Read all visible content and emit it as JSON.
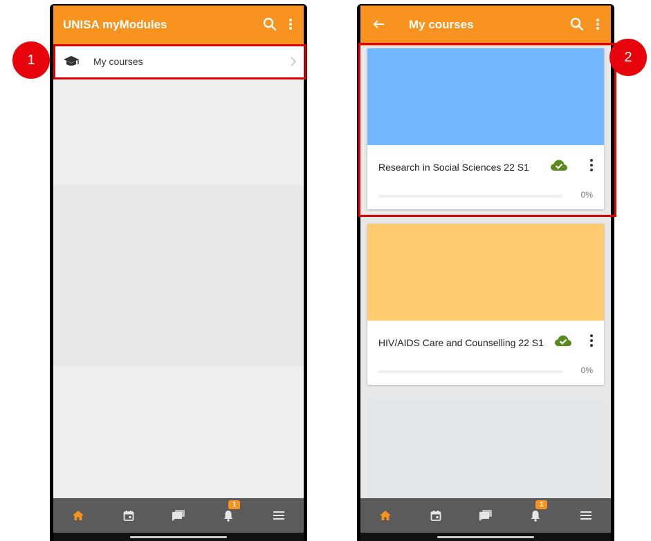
{
  "left_screen": {
    "app_title": "UNISA myModules",
    "menu_items": [
      {
        "label": "My courses"
      }
    ]
  },
  "right_screen": {
    "page_title": "My courses",
    "courses": [
      {
        "name": "Research in Social Sciences 22 S1",
        "progress_percent": 0,
        "progress_text": "0%",
        "image_color": "#72b7fd",
        "status_icon": "cloud-check-icon"
      },
      {
        "name": "HIV/AIDS Care and Counselling 22 S1",
        "progress_percent": 0,
        "progress_text": "0%",
        "image_color": "#fecb6f",
        "status_icon": "cloud-check-icon"
      }
    ]
  },
  "bottom_nav": {
    "items": [
      {
        "icon": "home-icon",
        "active": true
      },
      {
        "icon": "calendar-icon"
      },
      {
        "icon": "messages-icon"
      },
      {
        "icon": "notifications-icon",
        "badge": "1"
      },
      {
        "icon": "menu-icon"
      }
    ]
  },
  "annotations": [
    {
      "label": "1"
    },
    {
      "label": "2"
    }
  ],
  "colors": {
    "accent": "#f7931e",
    "highlight": "#e00000",
    "callout": "#e8040c",
    "cloud_check": "#5a8a1e"
  }
}
